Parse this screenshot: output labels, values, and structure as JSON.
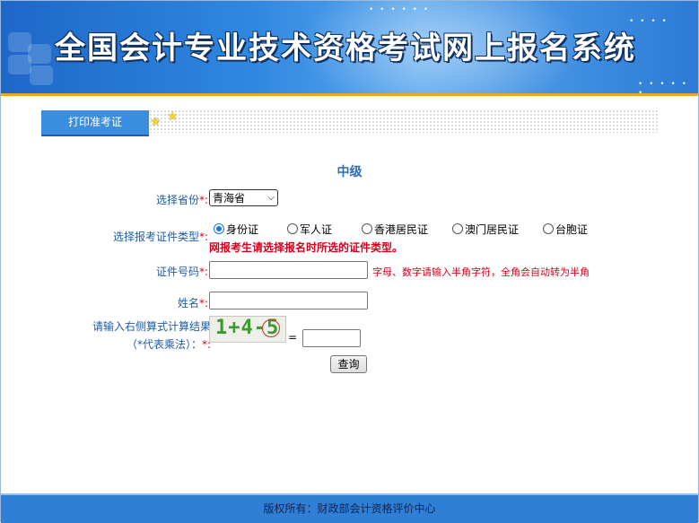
{
  "banner": {
    "title": "全国会计专业技术资格考试网上报名系统"
  },
  "tab": {
    "label": "打印准考证"
  },
  "form": {
    "level": "中级",
    "province": {
      "label": "选择省份",
      "required": "*:",
      "selected": "青海省"
    },
    "id_type": {
      "label": "选择报考证件类型",
      "required": "*:",
      "options": [
        "身份证",
        "军人证",
        "香港居民证",
        "澳门居民证",
        "台胞证"
      ],
      "selected_index": 0,
      "warning": "网报考生请选择报名时所选的证件类型。"
    },
    "id_number": {
      "label": "证件号码",
      "required": "*:",
      "value": "",
      "hint": "字母、数字请输入半角字符，全角会自动转为半角"
    },
    "name": {
      "label": "姓名",
      "required": "*:",
      "value": ""
    },
    "captcha": {
      "label_line1": "请输入右侧算式计算结果",
      "label_line2": "（*代表乘法）：",
      "required": "*:",
      "expression": "1+4-5",
      "equals": "=",
      "value": ""
    },
    "submit_label": "查询"
  },
  "footer": {
    "text": "版权所有：财政部会计资格评价中心"
  },
  "colors": {
    "banner_blue": "#2f86e0",
    "accent_orange": "#f5a21c",
    "required_red": "#e0001a",
    "label_blue": "#1f5ca8"
  }
}
